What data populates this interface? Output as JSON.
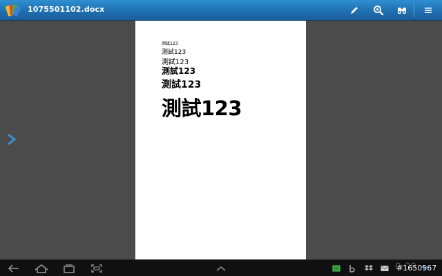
{
  "header": {
    "title": "1075501102.docx"
  },
  "document": {
    "lines": [
      "測試123",
      "測試123",
      "測試123",
      "測試123",
      "測試123",
      "測試123"
    ]
  },
  "statusbar": {
    "clock": "0:09",
    "watermark": "#1650567"
  },
  "colors": {
    "toolbar": "#1f6fb0",
    "page": "#ffffff",
    "workspace": "#4b4b4b",
    "nav_arrow": "#3a8fd6"
  }
}
